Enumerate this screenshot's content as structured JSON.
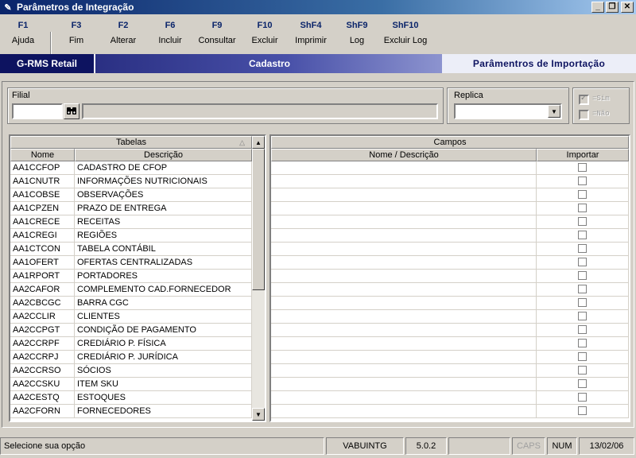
{
  "window": {
    "title": "Parâmetros de Integração"
  },
  "toolbar": {
    "items": [
      {
        "key": "F1",
        "label": "Ajuda"
      },
      {
        "key": "F3",
        "label": "Fim"
      },
      {
        "key": "F2",
        "label": "Alterar"
      },
      {
        "key": "F6",
        "label": "Incluir"
      },
      {
        "key": "F9",
        "label": "Consultar"
      },
      {
        "key": "F10",
        "label": "Excluir"
      },
      {
        "key": "ShF4",
        "label": "Imprimir"
      },
      {
        "key": "ShF9",
        "label": "Log"
      },
      {
        "key": "ShF10",
        "label": "Excluir Log"
      }
    ]
  },
  "banner": {
    "brand": "G-RMS Retail",
    "section": "Cadastro",
    "title": "Parâmentros de Importação"
  },
  "filter": {
    "filial_label": "Filial",
    "filial_value": "",
    "filial_desc": "",
    "replica_label": "Replica",
    "replica_value": "",
    "sim_label": "=Sim",
    "nao_label": "=Não"
  },
  "tabelas": {
    "title": "Tabelas",
    "col_nome": "Nome",
    "col_desc": "Descrição",
    "rows": [
      {
        "nome": "AA1CCFOP",
        "desc": "CADASTRO DE CFOP"
      },
      {
        "nome": "AA1CNUTR",
        "desc": "INFORMAÇÕES NUTRICIONAIS"
      },
      {
        "nome": "AA1COBSE",
        "desc": "OBSERVAÇÕES"
      },
      {
        "nome": "AA1CPZEN",
        "desc": "PRAZO DE ENTREGA"
      },
      {
        "nome": "AA1CRECE",
        "desc": "RECEITAS"
      },
      {
        "nome": "AA1CREGI",
        "desc": "REGIÕES"
      },
      {
        "nome": "AA1CTCON",
        "desc": "TABELA CONTÁBIL"
      },
      {
        "nome": "AA1OFERT",
        "desc": "OFERTAS CENTRALIZADAS"
      },
      {
        "nome": "AA1RPORT",
        "desc": "PORTADORES"
      },
      {
        "nome": "AA2CAFOR",
        "desc": "COMPLEMENTO CAD.FORNECEDOR"
      },
      {
        "nome": "AA2CBCGC",
        "desc": "BARRA CGC"
      },
      {
        "nome": "AA2CCLIR",
        "desc": "CLIENTES"
      },
      {
        "nome": "AA2CCPGT",
        "desc": "CONDIÇÃO DE PAGAMENTO"
      },
      {
        "nome": "AA2CCRPF",
        "desc": "CREDIÁRIO P. FÍSICA"
      },
      {
        "nome": "AA2CCRPJ",
        "desc": "CREDIÁRIO P. JURÍDICA"
      },
      {
        "nome": "AA2CCRSO",
        "desc": "SÓCIOS"
      },
      {
        "nome": "AA2CCSKU",
        "desc": "ITEM SKU"
      },
      {
        "nome": "AA2CESTQ",
        "desc": "ESTOQUES"
      },
      {
        "nome": "AA2CFORN",
        "desc": "FORNECEDORES"
      }
    ]
  },
  "campos": {
    "title": "Campos",
    "col_nome": "Nome / Descrição",
    "col_importar": "Importar",
    "row_count": 19
  },
  "statusbar": {
    "message": "Selecione sua opção",
    "program": "VABUINTG",
    "version": "5.0.2",
    "caps": "CAPS",
    "num": "NUM",
    "date": "13/02/06"
  },
  "colors": {
    "title_bar": "#0a246a",
    "banner_dark": "#0d1360",
    "face": "#d4d0c8"
  }
}
